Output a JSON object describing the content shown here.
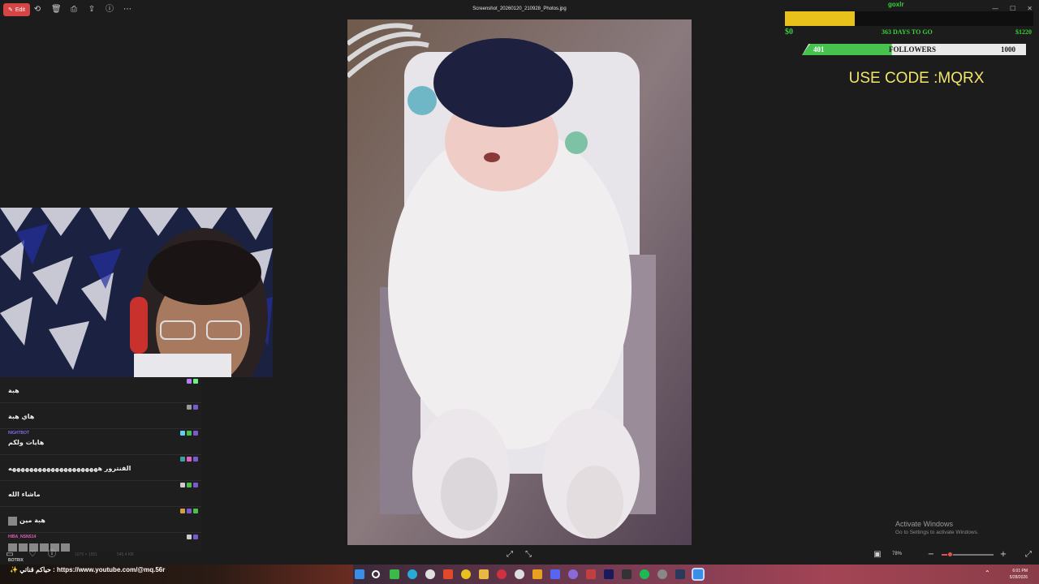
{
  "toolbar": {
    "edit_label": "Edit",
    "file_title": "Screenshot_20260120_210928_Photos.jpg",
    "icons": [
      "rotate-icon",
      "delete-icon",
      "print-icon",
      "share-icon",
      "info-icon",
      "more-icon"
    ]
  },
  "overlay": {
    "top_tag": "goxlr",
    "goal_current": "$0",
    "goal_days": "363 DAYS TO GO",
    "goal_target": "$1220",
    "goal_progress": 0.28,
    "followers_current": "401",
    "followers_label": "FOLLOWERS",
    "followers_goal": "1000",
    "followers_progress": 0.401,
    "promo": "USE CODE :MQRX"
  },
  "chat": {
    "messages": [
      {
        "user": "",
        "user_color": "#8d6ef0",
        "text": "هبة"
      },
      {
        "user": "",
        "user_color": "#d82c2c",
        "text": "هاي هبة"
      },
      {
        "user": "NIGHTBOT",
        "user_color": "#7a6cf0",
        "text": "هايات ولكم"
      },
      {
        "user": "",
        "user_color": "#666666",
        "text": "الفنترور هههههههههههههههههههههه"
      },
      {
        "user": "",
        "user_color": "#666666",
        "text": "ماشاء الله"
      },
      {
        "user": "",
        "user_color": "#4a6ee0",
        "text": "هبة مين"
      },
      {
        "user": "HIBA_NSNS14",
        "user_color": "#e05eb7",
        "text": ""
      }
    ],
    "botrix_label": "BOTRIX",
    "ticker": "✨ حياكم قناتي : https://www.youtube.com/@mq.56r"
  },
  "status": {
    "dimensions": "1079 × 1551",
    "size": "545.4 KB",
    "zoom": "78%",
    "zoom_level": 0.15
  },
  "windows": {
    "activate_title": "Activate Windows",
    "activate_sub": "Go to Settings to activate Windows."
  },
  "taskbar": {
    "time": "6:01 PM",
    "date": "5/28/2026"
  },
  "colors": {
    "edit_button": "#d64545",
    "goal_fill": "#e8c21a",
    "followers_fill": "#47c24e",
    "promo_text": "#f2e46a"
  }
}
